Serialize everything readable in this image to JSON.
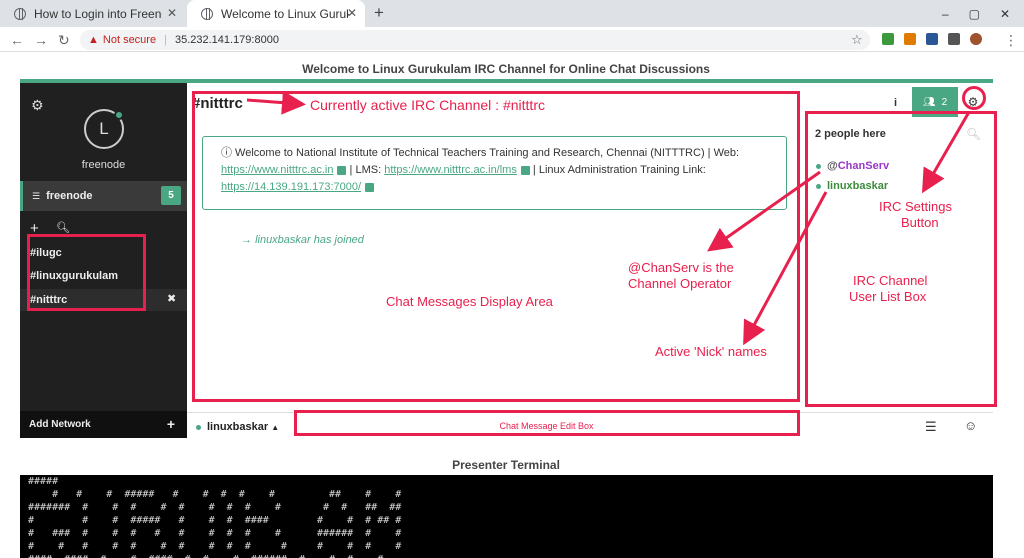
{
  "browser": {
    "tabs": [
      {
        "title": "How to Login into Freeno"
      },
      {
        "title": "Welcome to Linux Gurukul"
      }
    ],
    "new_tab": "+",
    "window_controls": {
      "minimize": "–",
      "maximize": "▢",
      "close": "✕"
    },
    "security_label": "Not secure",
    "url": "35.232.141.179:8000"
  },
  "page": {
    "title": "Welcome to Linux Gurukulam IRC Channel for Online Chat Discussions",
    "terminal_title": "Presenter Terminal"
  },
  "sidebar": {
    "avatar_letter": "L",
    "nick": "freenode",
    "network": {
      "name": "freenode",
      "badge": "5"
    },
    "channels": [
      "#ilugc",
      "#linuxgurukulam",
      "#nitttrc"
    ],
    "add_network": "Add Network"
  },
  "channel": {
    "name": "#nitttrc",
    "info_icon": "i",
    "user_count_badge": "2",
    "motd": {
      "prefix": "ⓘ Welcome to National Institute of Technical Teachers Training and Research, Chennai (NITTTRC) | Web:",
      "web_link": "https://www.nitttrc.ac.in",
      "lms_prefix": "| LMS:",
      "lms_link": "https://www.nitttrc.ac.in/lms",
      "linux_prefix": "| Linux Administration Training Link:",
      "linux_link": "https://14.139.191.173:7000/"
    },
    "join_message": {
      "arrow": "→",
      "user": "linuxbaskar",
      "text": "has joined"
    }
  },
  "userlist": {
    "count_label": "2 people here",
    "users": [
      {
        "prefix": "@",
        "name": "ChanServ"
      },
      {
        "prefix": "",
        "name": "linuxbaskar"
      }
    ]
  },
  "input": {
    "nick": "linuxbaskar",
    "caret": "▲",
    "placeholder": "Chat Message Edit Box"
  },
  "annotations": {
    "active_channel": "Currently active IRC Channel : #nitttrc",
    "chat_area": "Chat Messages Display Area",
    "chanserv_l1": "@ChanServ is the",
    "chanserv_l2": "Channel Operator",
    "active_nicks": "Active 'Nick' names",
    "settings_l1": "IRC Settings",
    "settings_l2": "Button",
    "userlist_l1": "IRC Channel",
    "userlist_l2": "User List Box"
  },
  "terminal": {
    "lines": [
      "#####",
      "    #   #    #  #####   #    #  #  #    #         ##    #    #",
      "#######  #    #  #    #  #    #  #  #    #       #  #   ##  ##",
      "#        #    #  #####   #    #  #  ####        #    #  # ## #",
      "#   ###  #    #  #   #   #    #  #  #    #      ######  #    #",
      "#    #   #    #  #    #  #    #  #  #     #     #    #  #    #",
      "####  ####  #    #  ####  #  #    #  ######  #    #  #    #"
    ]
  },
  "colors": {
    "accent": "#49a883",
    "annotation": "#e8204d",
    "sidebar_bg": "#202020",
    "operator_nick": "#9b36c8"
  }
}
